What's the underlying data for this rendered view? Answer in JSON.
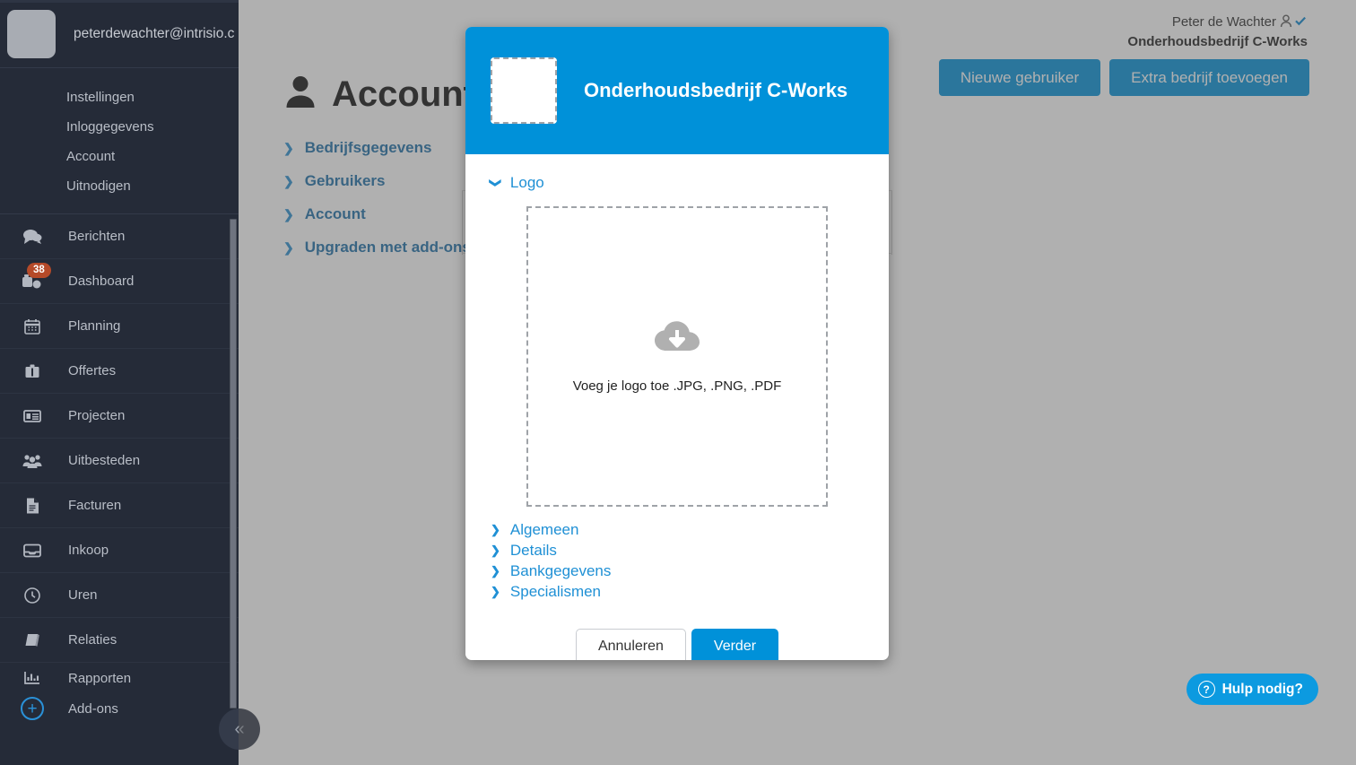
{
  "colors": {
    "brand_blue": "#0091d9",
    "sidebar_bg": "#252b38",
    "badge_orange": "#b54a29",
    "link_blue": "#1f90d5",
    "section_link_blue": "#1b6ea8",
    "overlay": "rgba(90,90,90,0.48)"
  },
  "sidebar": {
    "account_email": "peterdewachter@intrisio.c ...",
    "account_links": [
      {
        "label": "Instellingen"
      },
      {
        "label": "Inloggegevens"
      },
      {
        "label": "Account"
      },
      {
        "label": "Uitnodigen"
      }
    ],
    "nav_items": [
      {
        "label": "Berichten",
        "icon": "chat-bubbles-icon",
        "badge": null
      },
      {
        "label": "Dashboard",
        "icon": "dashboard-gauge-icon",
        "badge": "38"
      },
      {
        "label": "Planning",
        "icon": "calendar-icon",
        "badge": null
      },
      {
        "label": "Offertes",
        "icon": "briefcase-icon",
        "badge": null
      },
      {
        "label": "Projecten",
        "icon": "list-card-icon",
        "badge": null
      },
      {
        "label": "Uitbesteden",
        "icon": "people-group-icon",
        "badge": null
      },
      {
        "label": "Facturen",
        "icon": "document-icon",
        "badge": null
      },
      {
        "label": "Inkoop",
        "icon": "inbox-tray-icon",
        "badge": null
      },
      {
        "label": "Uren",
        "icon": "clock-icon",
        "badge": null
      },
      {
        "label": "Relaties",
        "icon": "address-book-icon",
        "badge": null
      },
      {
        "label": "Rapporten",
        "icon": "bar-chart-icon",
        "badge": null
      },
      {
        "label": "Add-ons",
        "icon": "plus-circle-icon",
        "badge": null
      }
    ],
    "collapse_label": "«"
  },
  "topbar": {
    "user_name": "Peter de Wachter",
    "company": "Onderhoudsbedrijf C-Works",
    "buttons": [
      {
        "label": "Nieuwe gebruiker"
      },
      {
        "label": "Extra bedrijf toevoegen"
      }
    ]
  },
  "page": {
    "title": "Account",
    "section_links": [
      {
        "label": "Bedrijfsgegevens"
      },
      {
        "label": "Gebruikers"
      },
      {
        "label": "Account"
      },
      {
        "label": "Upgraden met add-ons"
      }
    ]
  },
  "help": {
    "label": "Hulp nodig?",
    "icon": "question-mark-circle-icon"
  },
  "modal": {
    "title": "Onderhoudsbedrijf C-Works",
    "logo_placeholder_name": "company-logo-placeholder",
    "open_section": {
      "label": "Logo",
      "chevron": "⌄"
    },
    "dropzone": {
      "text": "Voeg je logo toe .JPG, .PNG, .PDF",
      "icon": "cloud-download-icon"
    },
    "sections": [
      {
        "label": "Algemeen"
      },
      {
        "label": "Details"
      },
      {
        "label": "Bankgegevens"
      },
      {
        "label": "Specialismen"
      }
    ],
    "buttons": {
      "cancel": "Annuleren",
      "confirm": "Verder"
    }
  }
}
